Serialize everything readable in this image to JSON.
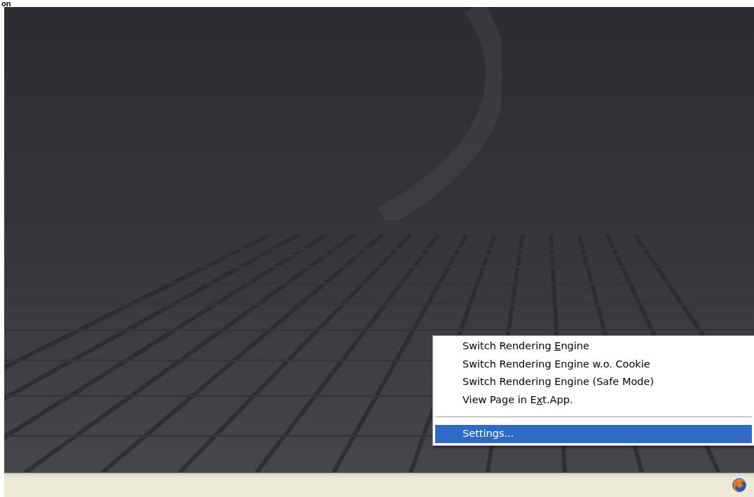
{
  "page_heading": "on",
  "context_menu": {
    "items": [
      {
        "kind": "item",
        "before": "Switch Rendering ",
        "key": "E",
        "after": "ngine",
        "selected": false
      },
      {
        "kind": "item",
        "before": "Switch Rendering Engine w.o. Cookie",
        "selected": false
      },
      {
        "kind": "item",
        "before": "Switch Rendering Engine (Safe Mode)",
        "selected": false
      },
      {
        "kind": "item",
        "before": "View Page in E",
        "key": "x",
        "after": "t.App.",
        "selected": false
      },
      {
        "kind": "separator"
      },
      {
        "kind": "item",
        "before": "Settings...",
        "selected": true
      }
    ]
  }
}
